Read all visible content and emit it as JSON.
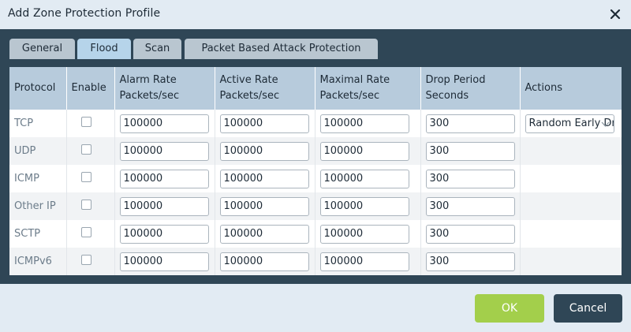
{
  "dialog": {
    "title": "Add Zone Protection Profile",
    "close_icon": "close-icon"
  },
  "tabs": [
    {
      "label": "General",
      "active": false
    },
    {
      "label": "Flood",
      "active": true
    },
    {
      "label": "Scan",
      "active": false
    },
    {
      "label": "Packet Based Attack Protection",
      "active": false
    }
  ],
  "table": {
    "headers": {
      "protocol": "Protocol",
      "enable": "Enable",
      "alarm_rate_1": "Alarm Rate",
      "alarm_rate_2": "Packets/sec",
      "active_rate_1": "Active Rate",
      "active_rate_2": "Packets/sec",
      "maximal_rate_1": "Maximal Rate",
      "maximal_rate_2": "Packets/sec",
      "drop_period_1": "Drop Period",
      "drop_period_2": "Seconds",
      "actions": "Actions"
    },
    "rows": [
      {
        "protocol": "TCP",
        "enabled": false,
        "alarm": "100000",
        "active": "100000",
        "maximal": "100000",
        "drop": "300",
        "action": "Random Early Drop"
      },
      {
        "protocol": "UDP",
        "enabled": false,
        "alarm": "100000",
        "active": "100000",
        "maximal": "100000",
        "drop": "300",
        "action": ""
      },
      {
        "protocol": "ICMP",
        "enabled": false,
        "alarm": "100000",
        "active": "100000",
        "maximal": "100000",
        "drop": "300",
        "action": ""
      },
      {
        "protocol": "Other IP",
        "enabled": false,
        "alarm": "100000",
        "active": "100000",
        "maximal": "100000",
        "drop": "300",
        "action": ""
      },
      {
        "protocol": "SCTP",
        "enabled": false,
        "alarm": "100000",
        "active": "100000",
        "maximal": "100000",
        "drop": "300",
        "action": ""
      },
      {
        "protocol": "ICMPv6",
        "enabled": false,
        "alarm": "100000",
        "active": "100000",
        "maximal": "100000",
        "drop": "300",
        "action": ""
      }
    ]
  },
  "footer": {
    "ok_label": "OK",
    "cancel_label": "Cancel"
  },
  "colors": {
    "ok_button": "#a3cf4b",
    "cancel_button": "#2f4656",
    "header_bg": "#b7cbdc",
    "active_tab": "#b6d4ea"
  }
}
